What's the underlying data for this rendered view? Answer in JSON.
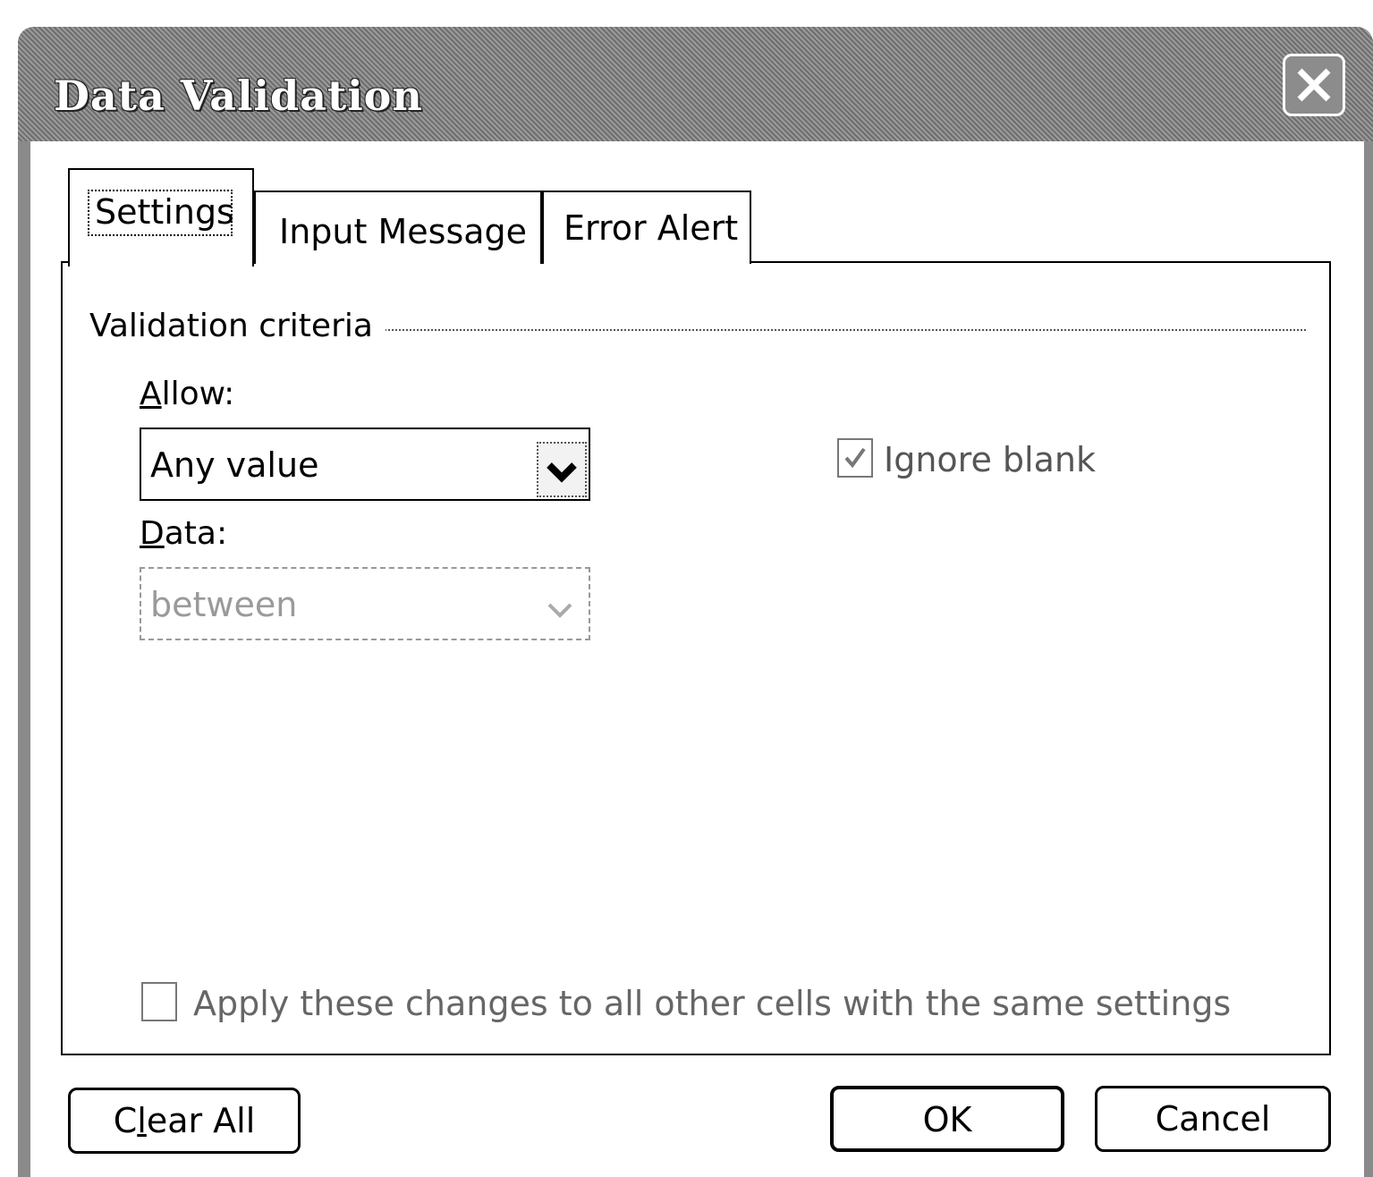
{
  "window": {
    "title": "Data Validation"
  },
  "tabs": [
    {
      "label": "Settings",
      "active": true
    },
    {
      "label": "Input Message",
      "active": false
    },
    {
      "label": "Error Alert",
      "active": false
    }
  ],
  "settings": {
    "group_label": "Validation criteria",
    "allow": {
      "label_first": "A",
      "label_rest": "llow:",
      "value": "Any value"
    },
    "data": {
      "label_first": "D",
      "label_rest": "ata:",
      "value": "between",
      "disabled": true
    },
    "ignore_blank": {
      "label": "Ignore blank",
      "checked": true,
      "disabled": true
    },
    "apply_all": {
      "label": "Apply these changes to all other cells with the same settings",
      "checked": false,
      "disabled": true
    }
  },
  "buttons": {
    "clear_all_first": "C",
    "clear_all_u": "l",
    "clear_all_rest": "ear All",
    "ok": "OK",
    "cancel": "Cancel"
  },
  "icons": {
    "close": "close-icon",
    "dropdown": "chevron-down-icon",
    "checkmark": "checkmark-icon"
  }
}
